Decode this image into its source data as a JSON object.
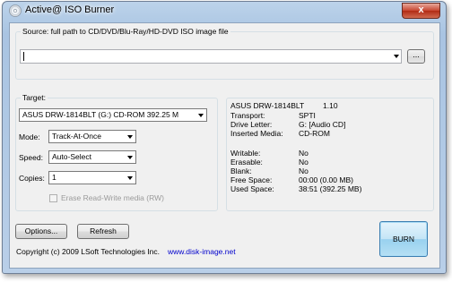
{
  "window": {
    "title": "Active@ ISO Burner",
    "close_label": "x"
  },
  "source": {
    "label": "Source: full path to CD/DVD/Blu-Ray/HD-DVD ISO image file",
    "value": "",
    "browse_label": "..."
  },
  "target": {
    "label": "Target:",
    "drive_selected": "ASUS     DRW-1814BLT     (G:)  CD-ROM 392.25 M",
    "mode_label": "Mode:",
    "mode_value": "Track-At-Once",
    "speed_label": "Speed:",
    "speed_value": "Auto-Select",
    "copies_label": "Copies:",
    "copies_value": "1",
    "erase_label": "Erase Read-Write media (RW)",
    "erase_checked": false
  },
  "drive_info": {
    "header_name": "ASUS     DRW-1814BLT",
    "header_version": "1.10",
    "rows1": [
      {
        "key": "Transport:",
        "value": "SPTI"
      },
      {
        "key": "Drive Letter:",
        "value": "G:   [Audio CD]"
      },
      {
        "key": "Inserted Media:",
        "value": "CD-ROM"
      }
    ],
    "rows2": [
      {
        "key": "Writable:",
        "value": "No"
      },
      {
        "key": "Erasable:",
        "value": "No"
      },
      {
        "key": "Blank:",
        "value": "No"
      },
      {
        "key": "Free Space:",
        "value": "00:00 (0.00 MB)"
      },
      {
        "key": "Used Space:",
        "value": "38:51 (392.25 MB)"
      }
    ]
  },
  "buttons": {
    "options": "Options...",
    "refresh": "Refresh",
    "burn": "BURN"
  },
  "footer": {
    "copyright": "Copyright (c) 2009 LSoft Technologies Inc.",
    "link": "www.disk-image.net"
  },
  "colors": {
    "link": "#0000cc",
    "burn_border": "#3c7fb1",
    "close": "#c7452f"
  }
}
